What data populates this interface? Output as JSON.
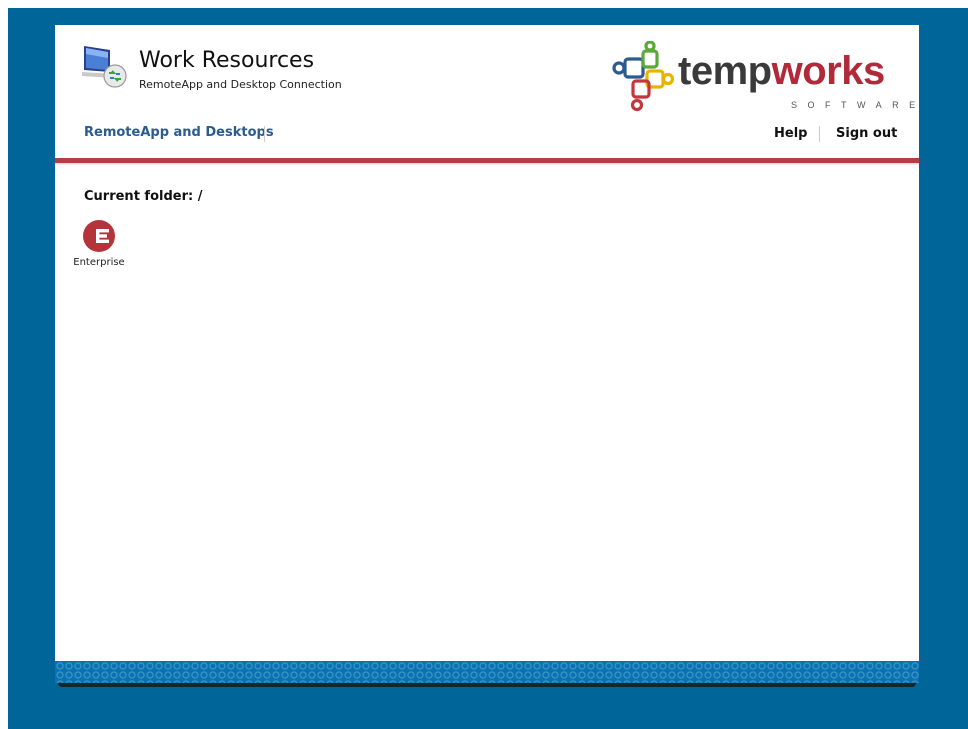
{
  "header": {
    "title": "Work Resources",
    "subtitle": "RemoteApp and Desktop Connection",
    "icon": "remote-desktop-icon"
  },
  "brand": {
    "name_part1": "temp",
    "name_part2": "works",
    "tagline": "SOFTWARE",
    "colors": {
      "dark": "#3a3a3a",
      "accent": "#b02a3a",
      "blue": "#2b5b8f",
      "green": "#5aa83a",
      "yellow": "#e8b400",
      "red": "#c4363f"
    }
  },
  "nav": {
    "left_link": "RemoteApp and Desktops",
    "help": "Help",
    "sign_out": "Sign out"
  },
  "content": {
    "folder_label": "Current folder: /",
    "apps": [
      {
        "label": "Enterprise",
        "icon": "enterprise-app-icon"
      }
    ]
  },
  "colors": {
    "frame": "#00669a",
    "rule": "#b83c44",
    "link": "#2b5b8f"
  }
}
